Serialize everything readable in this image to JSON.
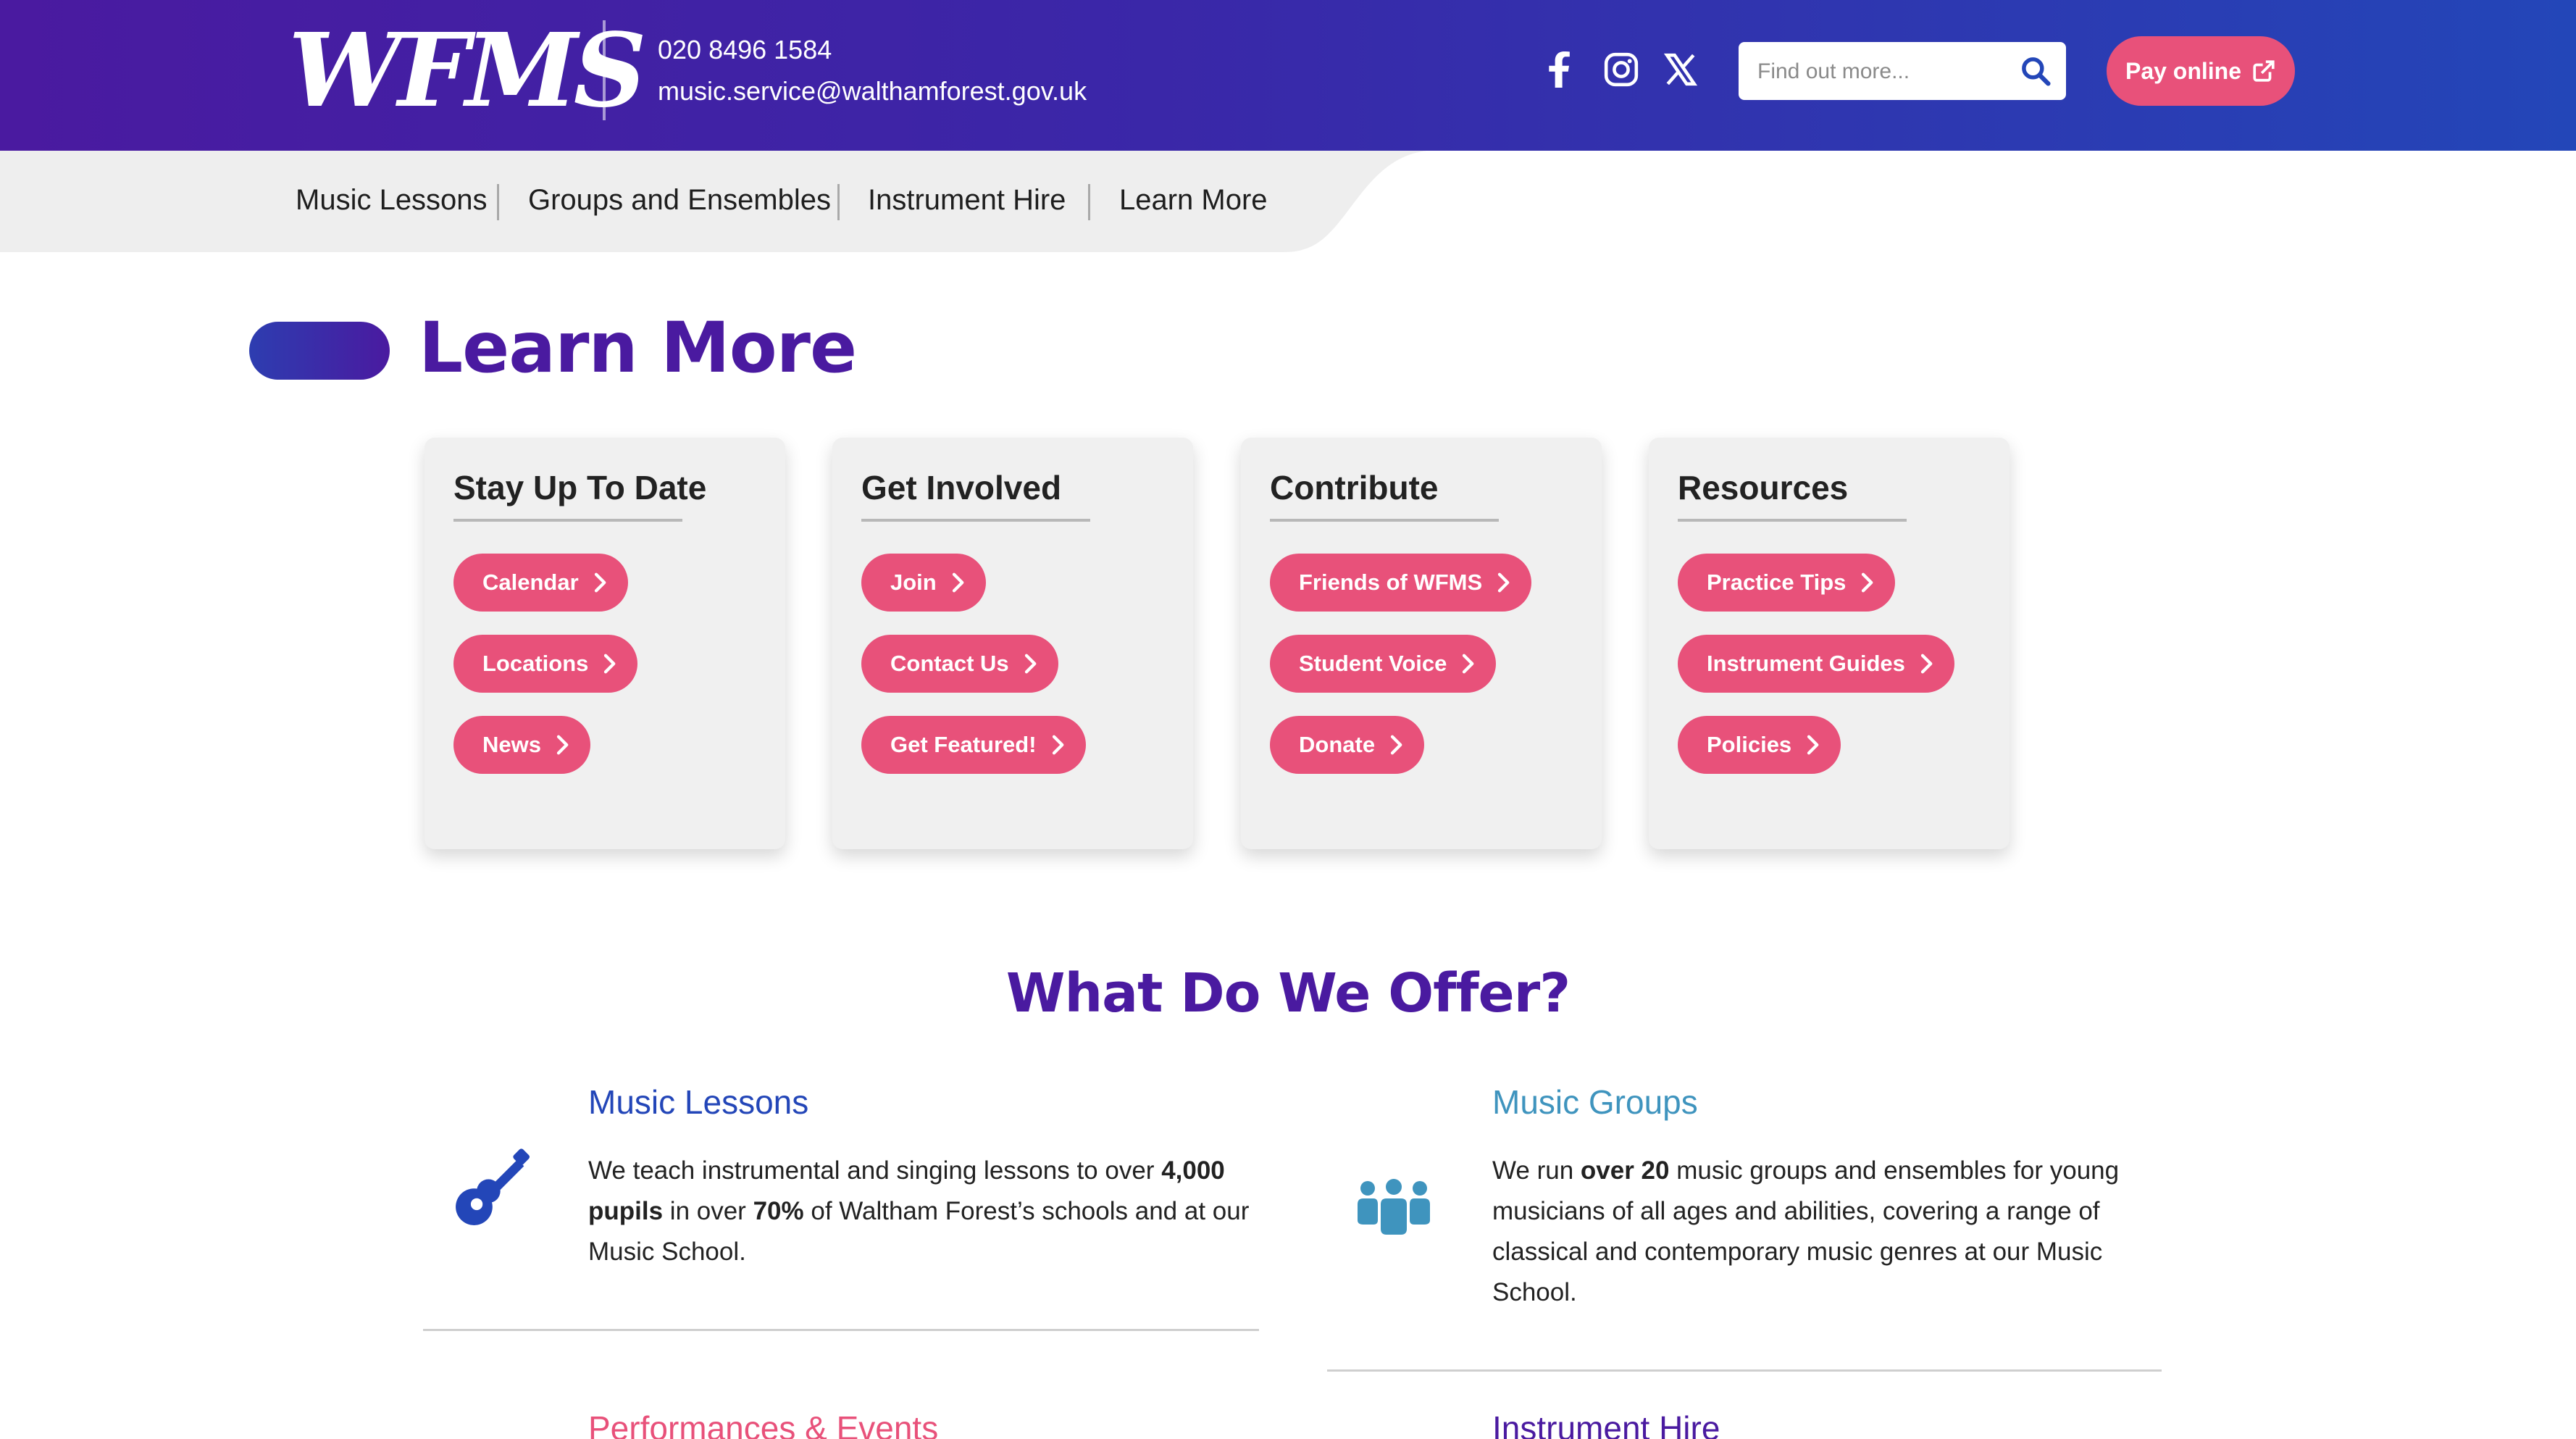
{
  "header": {
    "logo_text": "WFMS",
    "phone": "020 8496 1584",
    "email": "music.service@walthamforest.gov.uk",
    "social": [
      "facebook-icon",
      "instagram-icon",
      "x-icon"
    ],
    "search_placeholder": "Find out more...",
    "pay_label": "Pay online",
    "colors": {
      "gradient_start": "#4a1aa0",
      "gradient_end": "#2346b8",
      "accent_pink": "#e8517a"
    }
  },
  "nav": {
    "items": [
      {
        "label": "Music Lessons"
      },
      {
        "label": "Groups and Ensembles"
      },
      {
        "label": "Instrument Hire"
      },
      {
        "label": "Learn More"
      }
    ]
  },
  "main": {
    "title": "Learn More",
    "cards": [
      {
        "title": "Stay Up To Date",
        "links": [
          "Calendar",
          "Locations",
          "News"
        ]
      },
      {
        "title": "Get Involved",
        "links": [
          "Join",
          "Contact Us",
          "Get Featured!"
        ]
      },
      {
        "title": "Contribute",
        "links": [
          "Friends of WFMS",
          "Student Voice",
          "Donate"
        ]
      },
      {
        "title": "Resources",
        "links": [
          "Practice Tips",
          "Instrument Guides",
          "Policies"
        ]
      }
    ]
  },
  "offer": {
    "title": "What Do We Offer?",
    "items": [
      {
        "heading": "Music Lessons",
        "icon": "guitar-icon",
        "color": "#2346b8",
        "text_parts": [
          "We teach instrumental and singing lessons to over ",
          "4,000 pupils",
          " in over ",
          "70%",
          " of Waltham Forest’s schools and at our Music School."
        ]
      },
      {
        "heading": "Music Groups",
        "icon": "group-icon",
        "color": "#3f94be",
        "text_parts": [
          "We run ",
          "over 20",
          " music groups and ensembles for young musicians of all ages and abilities, covering a range of classical and contemporary music genres at our Music School."
        ]
      },
      {
        "heading": "Performances & Events",
        "color": "#e8517a"
      },
      {
        "heading": "Instrument Hire",
        "color": "#4a1aa0"
      }
    ]
  }
}
